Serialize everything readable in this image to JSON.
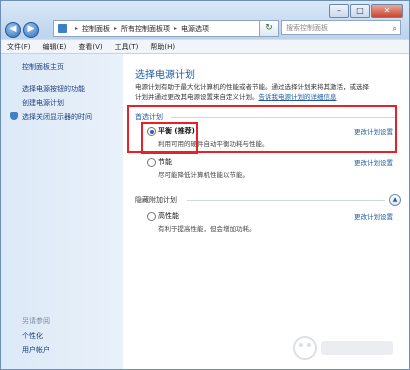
{
  "address": {
    "crumbs": [
      "控制面板",
      "所有控制面板项",
      "电源选项"
    ],
    "search_placeholder": "搜索控制面板"
  },
  "menu": [
    "文件(F)",
    "编辑(E)",
    "查看(V)",
    "工具(T)",
    "帮助(H)"
  ],
  "sidebar": {
    "items": [
      "控制面板主页",
      "选择电源按钮的功能",
      "创建电源计划",
      "选择关闭显示器的时间"
    ],
    "see_also": "另请参阅",
    "see_also_items": [
      "个性化",
      "用户帐户"
    ]
  },
  "main": {
    "title": "选择电源计划",
    "desc_line1": "电源计划有助于最大化计算机的性能或者节能。通过选择计划来将其激活，或选择",
    "desc_line2_prefix": "计划并通过更改其电源设置来自定义计划。",
    "desc_link": "告诉我电源计划的详细信息",
    "preferred_heading": "首选计划",
    "plans": [
      {
        "name": "平衡 (推荐)",
        "desc": "利用可用的硬件自动平衡功耗与性能。",
        "link": "更改计划设置",
        "selected": true
      },
      {
        "name": "节能",
        "desc": "尽可能降低计算机性能以节能。",
        "link": "更改计划设置",
        "selected": false
      }
    ],
    "hidden_heading": "隐藏附加计划",
    "hidden_plans": [
      {
        "name": "高性能",
        "desc": "有利于提高性能，但会增加功耗。",
        "link": "更改计划设置",
        "selected": false
      }
    ]
  },
  "colors": {
    "highlight_box": "#e2232a",
    "link": "#1d5aa0"
  }
}
